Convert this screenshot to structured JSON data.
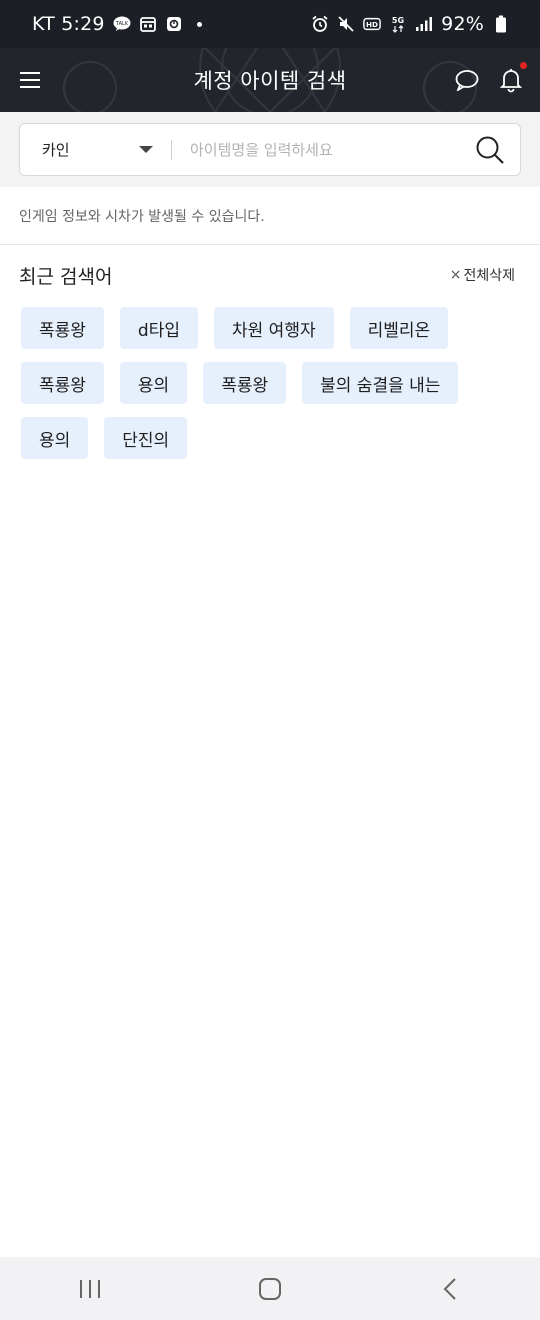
{
  "status_bar": {
    "carrier_time": "KT 5:29",
    "battery": "92%",
    "left_icons": [
      "talk-icon",
      "calendar-icon",
      "app-icon"
    ],
    "right_icons": [
      "alarm-icon",
      "mute-icon",
      "hd-icon",
      "5g-icon",
      "signal-icon",
      "battery-icon"
    ]
  },
  "header": {
    "title": "계정 아이템 검색",
    "menu_icon": "hamburger-menu-icon",
    "chat_icon": "chat-bubble-icon",
    "bell_icon": "bell-icon",
    "has_notification": true,
    "notification_color": "#e02424"
  },
  "search": {
    "server_value": "카인",
    "placeholder": "아이템명을 입력하세요",
    "search_icon": "search-icon"
  },
  "notice": "인게임 정보와 시차가 발생될 수 있습니다.",
  "recent": {
    "title": "최근 검색어",
    "clear_all": "전체삭제",
    "clear_icon": "×",
    "keywords": [
      "폭룡왕",
      "d타입",
      "차원 여행자",
      "리벨리온",
      "폭룡왕",
      "용의",
      "폭룡왕",
      "불의 숨결을 내는",
      "용의",
      "단진의"
    ]
  },
  "nav": {
    "recents_icon": "recent-apps-icon",
    "home_icon": "home-icon",
    "back_icon": "back-icon"
  },
  "colors": {
    "header_bg": "#22252c",
    "chip_bg": "#e6effc",
    "status_bg": "#1c1f26"
  }
}
